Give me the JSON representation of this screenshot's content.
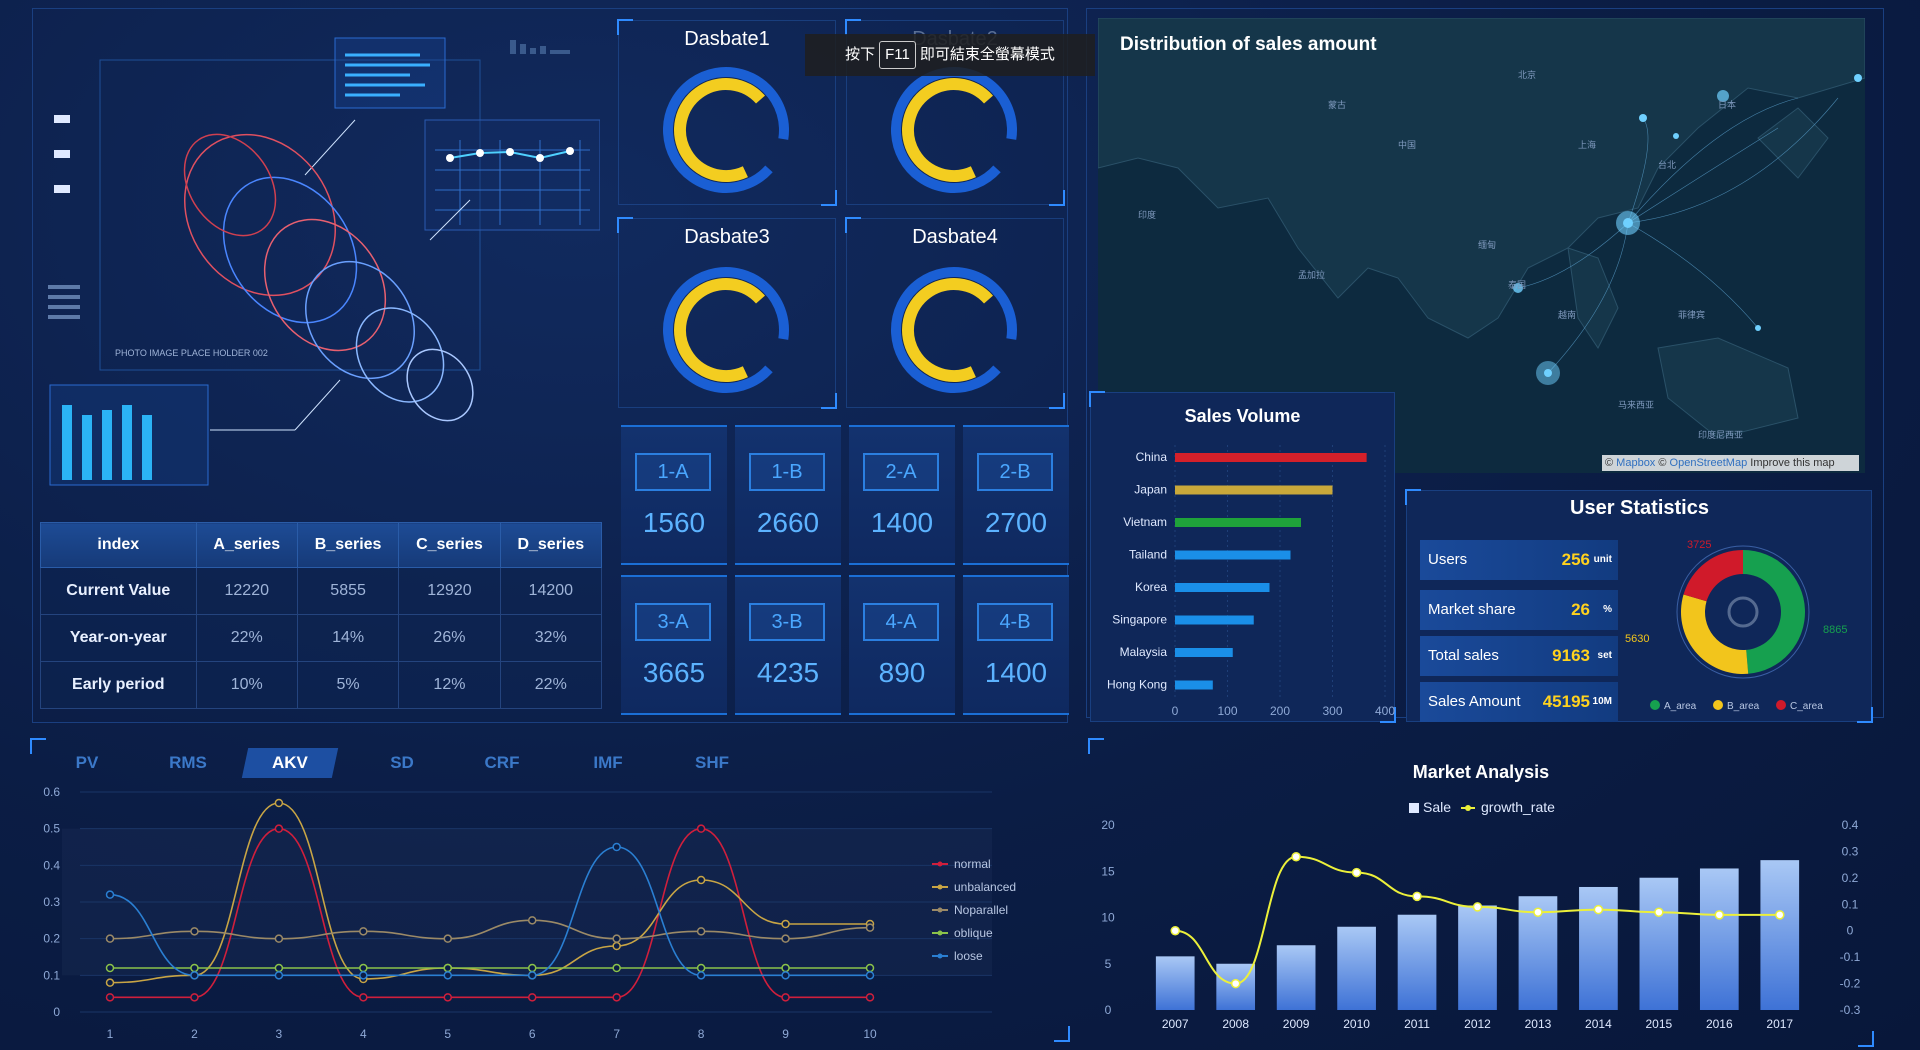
{
  "tooltip": {
    "pre": "按下",
    "key": "F11",
    "post": "即可結束全螢幕模式"
  },
  "left_top": {
    "photo_caption": "PHOTO IMAGE PLACE HOLDER 002"
  },
  "table": {
    "headers": [
      "index",
      "A_series",
      "B_series",
      "C_series",
      "D_series"
    ],
    "rows": [
      [
        "Current Value",
        "12220",
        "5855",
        "12920",
        "14200"
      ],
      [
        "Year-on-year",
        "22%",
        "14%",
        "26%",
        "32%"
      ],
      [
        "Early period",
        "10%",
        "5%",
        "12%",
        "22%"
      ]
    ]
  },
  "gauges": [
    {
      "label": "Dasbate1",
      "value": 0.68
    },
    {
      "label": "Dasbate2",
      "value": 0.68
    },
    {
      "label": "Dasbate3",
      "value": 0.68
    },
    {
      "label": "Dasbate4",
      "value": 0.68
    }
  ],
  "tiles": [
    {
      "tag": "1-A",
      "value": "1560"
    },
    {
      "tag": "1-B",
      "value": "2660"
    },
    {
      "tag": "2-A",
      "value": "1400"
    },
    {
      "tag": "2-B",
      "value": "2700"
    },
    {
      "tag": "3-A",
      "value": "3665"
    },
    {
      "tag": "3-B",
      "value": "4235"
    },
    {
      "tag": "4-A",
      "value": "890"
    },
    {
      "tag": "4-B",
      "value": "1400"
    }
  ],
  "map": {
    "title": "Distribution of sales amount",
    "attribution": {
      "symbol": "©",
      "mapbox": "Mapbox",
      "osm": "OpenStreetMap",
      "improve": "Improve this map"
    }
  },
  "sales_volume": {
    "title": "Sales Volume"
  },
  "user_stats": {
    "title": "User Statistics",
    "rows": [
      {
        "label": "Users",
        "value": "256",
        "unit": "unit"
      },
      {
        "label": "Market share",
        "value": "26",
        "unit": "%"
      },
      {
        "label": "Total sales",
        "value": "9163",
        "unit": "set"
      },
      {
        "label": "Sales Amount",
        "value": "45195",
        "unit": "10M"
      }
    ]
  },
  "tabs": [
    "PV",
    "RMS",
    "AKV",
    "SD",
    "CRF",
    "IMF",
    "SHF"
  ],
  "active_tab": "AKV",
  "market": {
    "title": "Market Analysis"
  },
  "colors": {
    "accent": "#2f8bff",
    "gold": "#ffd21e",
    "green": "#1aa35a",
    "red": "#d01a2a"
  },
  "chart_data": [
    {
      "type": "bar",
      "orientation": "horizontal",
      "title": "Sales Volume",
      "categories": [
        "China",
        "Japan",
        "Vietnam",
        "Tailand",
        "Korea",
        "Singapore",
        "Malaysia",
        "Hong Kong"
      ],
      "values": [
        365,
        300,
        240,
        220,
        180,
        150,
        110,
        72
      ],
      "colors": [
        "#d4202a",
        "#c9a83a",
        "#1fa33a",
        "#1a8fe8",
        "#1a8fe8",
        "#1a8fe8",
        "#1a8fe8",
        "#1a8fe8"
      ],
      "xticks": [
        "0",
        "100",
        "200",
        "300",
        "400"
      ],
      "xlim": [
        0,
        400
      ]
    },
    {
      "type": "pie",
      "title": "",
      "slices": [
        {
          "name": "A_area",
          "value": 8865,
          "color": "#16a04f"
        },
        {
          "name": "B_area",
          "value": 5630,
          "color": "#f2c51c"
        },
        {
          "name": "C_area",
          "value": 3725,
          "color": "#d01a2a"
        }
      ],
      "labels": [
        "3725",
        "5630",
        "8865"
      ]
    },
    {
      "type": "line",
      "title": "",
      "x": [
        "1",
        "2",
        "3",
        "4",
        "5",
        "6",
        "7",
        "8",
        "9",
        "10"
      ],
      "ylim": [
        0,
        0.6
      ],
      "yticks": [
        "0",
        "0.1",
        "0.2",
        "0.3",
        "0.4",
        "0.5",
        "0.6"
      ],
      "series": [
        {
          "name": "normal",
          "color": "#d01f3c",
          "values": [
            0.04,
            0.04,
            0.5,
            0.04,
            0.04,
            0.04,
            0.04,
            0.5,
            0.04,
            0.04
          ]
        },
        {
          "name": "unbalanced",
          "color": "#c8a545",
          "values": [
            0.08,
            0.1,
            0.57,
            0.09,
            0.12,
            0.1,
            0.18,
            0.36,
            0.24,
            0.24
          ]
        },
        {
          "name": "Noparallel",
          "color": "#9b8a67",
          "values": [
            0.2,
            0.22,
            0.2,
            0.22,
            0.2,
            0.25,
            0.2,
            0.22,
            0.2,
            0.23
          ]
        },
        {
          "name": "oblique",
          "color": "#8bc34a",
          "values": [
            0.12,
            0.12,
            0.12,
            0.12,
            0.12,
            0.12,
            0.12,
            0.12,
            0.12,
            0.12
          ]
        },
        {
          "name": "loose",
          "color": "#2a7fd2",
          "values": [
            0.32,
            0.1,
            0.1,
            0.1,
            0.1,
            0.1,
            0.45,
            0.1,
            0.1,
            0.1
          ]
        }
      ]
    },
    {
      "type": "bar",
      "title": "Market Analysis",
      "categories": [
        "2007",
        "2008",
        "2009",
        "2010",
        "2011",
        "2012",
        "2013",
        "2014",
        "2015",
        "2016",
        "2017"
      ],
      "series": [
        {
          "name": "Sale",
          "values": [
            5.8,
            5.0,
            7.0,
            9.0,
            10.3,
            11.3,
            12.3,
            13.3,
            14.3,
            15.3,
            16.2
          ],
          "color": "#5b8fe0"
        },
        {
          "name": "growth_rate",
          "type": "line",
          "axis": "right",
          "values": [
            0.0,
            -0.2,
            0.28,
            0.22,
            0.13,
            0.09,
            0.07,
            0.08,
            0.07,
            0.06,
            0.06
          ],
          "color": "#ecf03a"
        }
      ],
      "ylim": [
        0,
        20
      ],
      "yticks": [
        "0",
        "5",
        "10",
        "15",
        "20"
      ],
      "y2lim": [
        -0.3,
        0.4
      ],
      "y2ticks": [
        "-0.3",
        "-0.2",
        "-0.1",
        "0",
        "0.1",
        "0.2",
        "0.3",
        "0.4"
      ]
    }
  ]
}
